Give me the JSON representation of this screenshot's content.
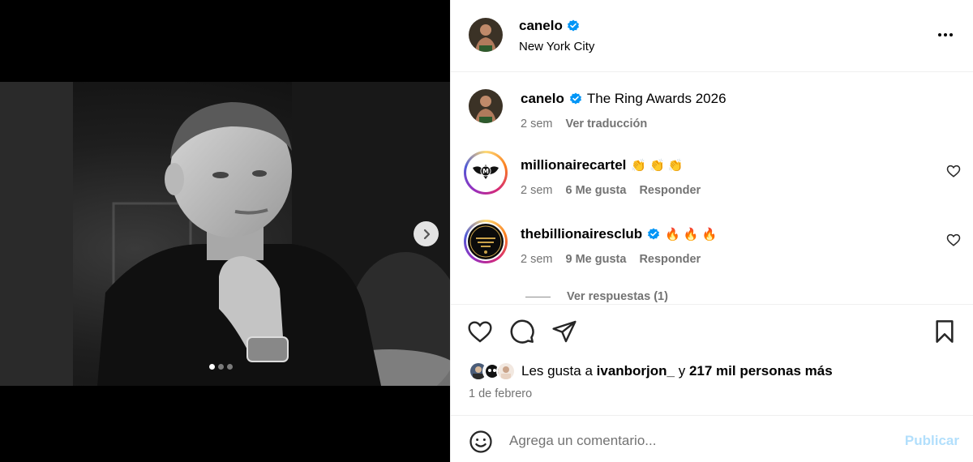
{
  "post": {
    "author": "canelo",
    "location": "New York City",
    "verified": true,
    "carousel": {
      "total": 3,
      "active": 1
    }
  },
  "caption": {
    "user": "canelo",
    "text": "The Ring Awards 2026",
    "time": "2 sem",
    "translate": "Ver traducción"
  },
  "comments": [
    {
      "user": "millionairecartel",
      "text": "👏👏👏",
      "time": "2 sem",
      "likes": "6 Me gusta",
      "reply": "Responder",
      "verified": false
    },
    {
      "user": "thebillionairesclub",
      "text": "🔥🔥🔥",
      "time": "2 sem",
      "likes": "9 Me gusta",
      "reply": "Responder",
      "verified": true
    }
  ],
  "replies": {
    "label": "Ver respuestas (1)"
  },
  "likes": {
    "prefix": "Les gusta a",
    "user": "ivanborjon_",
    "middle": "y",
    "count": "217 mil personas más"
  },
  "date": "1 de febrero",
  "composer": {
    "placeholder": "Agrega un comentario...",
    "publish": "Publicar"
  },
  "icons": {
    "more": "more-options-icon",
    "like": "heart-icon",
    "comment": "comment-icon",
    "share": "share-icon",
    "save": "bookmark-icon",
    "emoji": "emoji-icon",
    "next": "chevron-right-icon",
    "verified": "verified-badge-icon"
  },
  "colors": {
    "verified": "#0095f6",
    "muted": "#737373",
    "publish_disabled": "#b2dffc",
    "border": "#efefef"
  }
}
